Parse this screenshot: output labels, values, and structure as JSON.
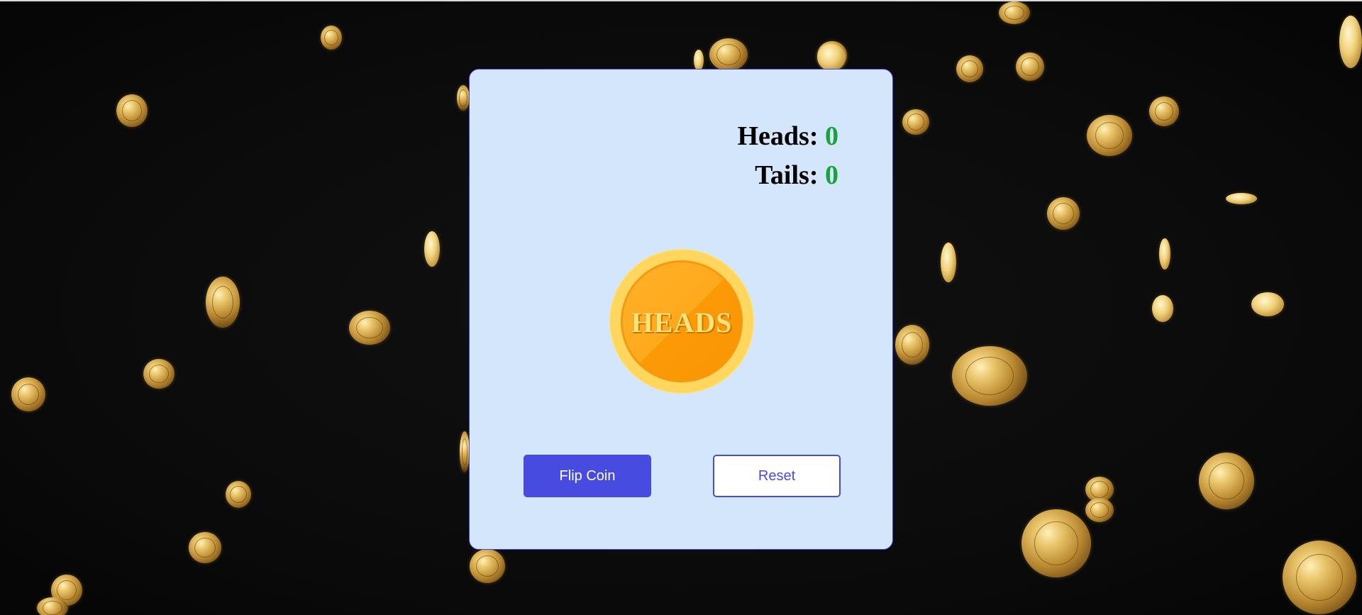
{
  "scoreboard": {
    "heads_label": "Heads:",
    "heads_count": "0",
    "tails_label": "Tails:",
    "tails_count": "0"
  },
  "coin": {
    "face": "HEADS"
  },
  "controls": {
    "flip_label": "Flip Coin",
    "reset_label": "Reset"
  },
  "colors": {
    "card_background": "#d4e6fc",
    "accent": "#474be0",
    "count_color": "#1aa33a",
    "coin_outer": "#ffd75e",
    "coin_inner": "#ffa91c"
  },
  "background": {
    "theme": "falling gold coins on black"
  }
}
